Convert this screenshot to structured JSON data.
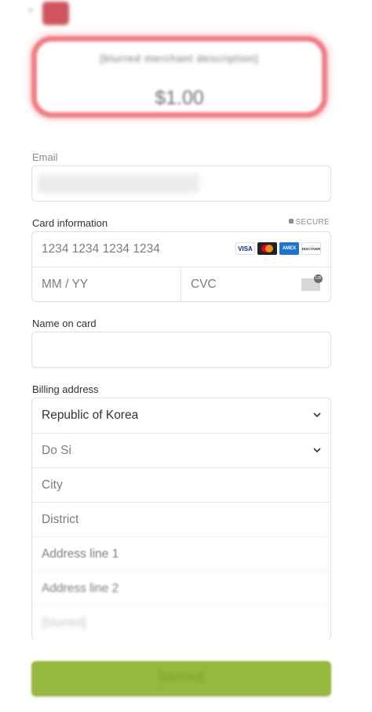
{
  "summary": {
    "description": "[blurred merchant description]",
    "amount": "$1.00"
  },
  "email": {
    "label": "Email",
    "value": ""
  },
  "card": {
    "label": "Card information",
    "secure_label": "SECURE",
    "number_placeholder": "1234 1234 1234 1234",
    "expiry_placeholder": "MM / YY",
    "cvc_placeholder": "CVC",
    "brands": [
      "VISA",
      "mastercard",
      "AMEX",
      "DISCOVER"
    ],
    "cvc_hint": "135"
  },
  "name_on_card": {
    "label": "Name on card",
    "value": ""
  },
  "billing": {
    "label": "Billing address",
    "country": "Republic of Korea",
    "province_placeholder": "Do Si",
    "city_placeholder": "City",
    "district_placeholder": "District",
    "address1_placeholder": "Address line 1",
    "address2_placeholder": "Address line 2",
    "postal_placeholder": "[blurred]"
  },
  "pay_button": {
    "label": "[blurred]"
  },
  "colors": {
    "accent_border": "#ef7f85",
    "pay_button": "#97b83f",
    "logo": "#c9434d"
  }
}
